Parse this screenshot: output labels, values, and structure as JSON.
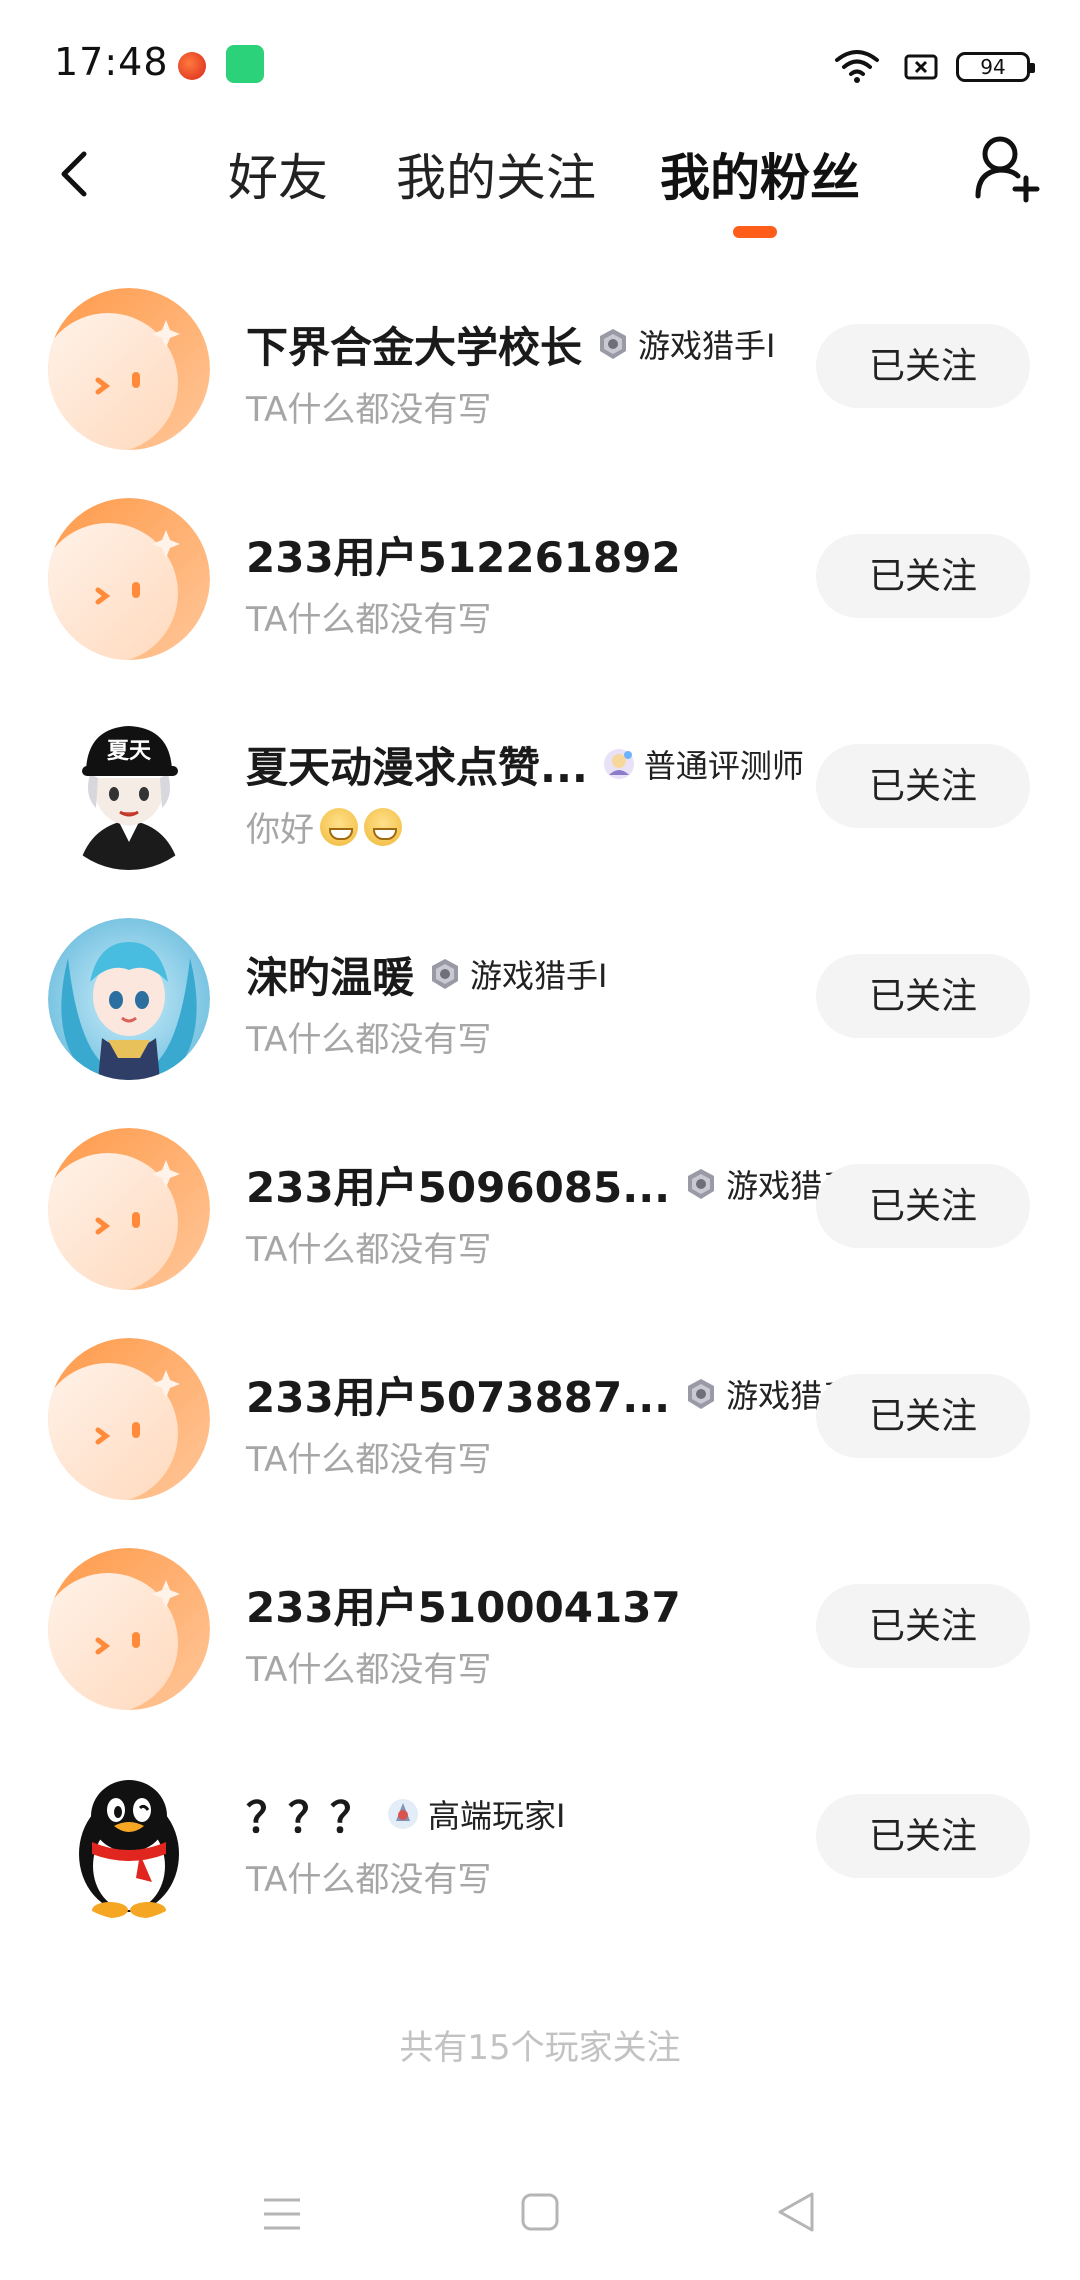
{
  "status_bar": {
    "time": "17:48",
    "battery": "94"
  },
  "header": {
    "tabs": [
      {
        "label": "好友"
      },
      {
        "label": "我的关注"
      },
      {
        "label": "我的粉丝"
      }
    ],
    "active_tab": "我的粉丝",
    "accent_color": "#ff5e1a"
  },
  "fans": [
    {
      "name": "下界合金大学校长",
      "badge": "游戏猎手I",
      "badge_icon": "hunter-badge-icon",
      "bio": "TA什么都没有写",
      "button": "已关注",
      "avatar": "default-orange-avatar"
    },
    {
      "name": "233用户512261892",
      "badge": "",
      "badge_icon": "",
      "bio": "TA什么都没有写",
      "button": "已关注",
      "avatar": "default-orange-avatar"
    },
    {
      "name": "夏天动漫求点赞...",
      "badge": "普通评测师",
      "badge_icon": "reviewer-badge-icon",
      "bio": "你好",
      "bio_emoji_count": 2,
      "button": "已关注",
      "avatar": "anime-boy-cap-avatar",
      "cap_text": "夏天"
    },
    {
      "name": "浨旳温暖",
      "badge": "游戏猎手I",
      "badge_icon": "hunter-badge-icon",
      "bio": "TA什么都没有写",
      "button": "已关注",
      "avatar": "anime-girl-blue-hair-avatar"
    },
    {
      "name": "233用户5096085...",
      "badge": "游戏猎手I",
      "badge_icon": "hunter-badge-icon",
      "bio": "TA什么都没有写",
      "button": "已关注",
      "avatar": "default-orange-avatar"
    },
    {
      "name": "233用户5073887...",
      "badge": "游戏猎手I",
      "badge_icon": "hunter-badge-icon",
      "bio": "TA什么都没有写",
      "button": "已关注",
      "avatar": "default-orange-avatar"
    },
    {
      "name": "233用户510004137",
      "badge": "",
      "badge_icon": "",
      "bio": "TA什么都没有写",
      "button": "已关注",
      "avatar": "default-orange-avatar"
    },
    {
      "name": "？？？",
      "badge": "高端玩家I",
      "badge_icon": "pro-player-badge-icon",
      "bio": "TA什么都没有写",
      "button": "已关注",
      "avatar": "penguin-avatar"
    }
  ],
  "footer": {
    "summary": "共有15个玩家关注"
  }
}
